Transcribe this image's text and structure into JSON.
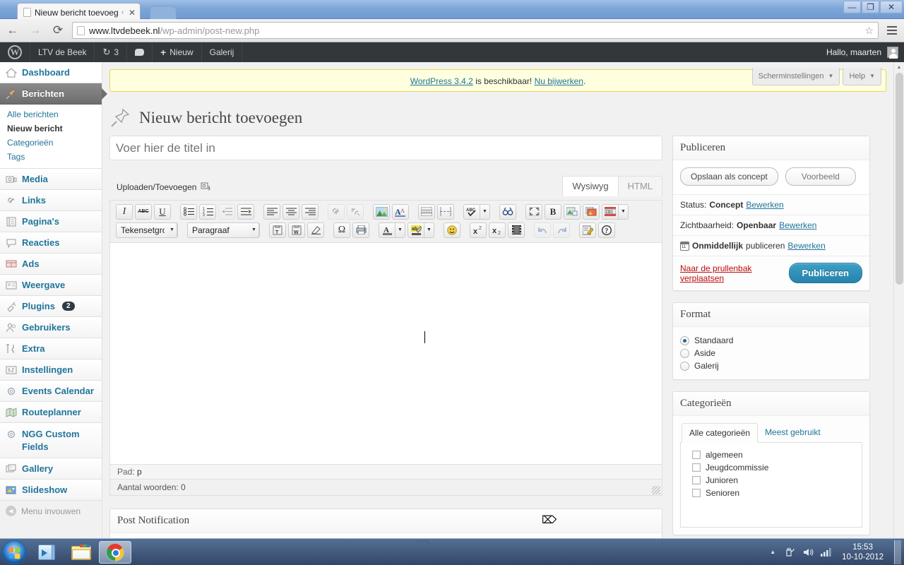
{
  "browser": {
    "tab_title": "Nieuw bericht toevoegen",
    "tab_separator": "‹",
    "tab_close": "✕",
    "back_icon": "←",
    "forward_icon": "→",
    "reload_icon": "⟳",
    "url_host": "www.ltvdebeek.nl",
    "url_path": "/wp-admin/post-new.php",
    "star_icon": "☆",
    "minimize_label": "—",
    "maximize_label": "❐",
    "close_label": "✕"
  },
  "adminbar": {
    "logo": "W",
    "site_name": "LTV de Beek",
    "updates_icon": "↻",
    "updates_count": "3",
    "comments_icon": "💬",
    "new_label": "Nieuw",
    "new_plus": "+",
    "gallery_label": "Galerij",
    "greeting": "Hallo, maarten"
  },
  "sidebar": {
    "items": [
      {
        "label": "Dashboard",
        "icon": "dashboard-icon"
      },
      {
        "label": "Berichten",
        "icon": "posts-pin-icon",
        "current": true
      },
      {
        "label": "Media",
        "icon": "media-icon"
      },
      {
        "label": "Links",
        "icon": "links-icon"
      },
      {
        "label": "Pagina's",
        "icon": "pages-icon"
      },
      {
        "label": "Reacties",
        "icon": "comments-icon"
      },
      {
        "label": "Ads",
        "icon": "ads-icon"
      },
      {
        "label": "Weergave",
        "icon": "appearance-icon"
      },
      {
        "label": "Plugins",
        "icon": "plugins-icon",
        "badge": "2"
      },
      {
        "label": "Gebruikers",
        "icon": "users-icon"
      },
      {
        "label": "Extra",
        "icon": "tools-icon"
      },
      {
        "label": "Instellingen",
        "icon": "settings-icon"
      },
      {
        "label": "Events Calendar",
        "icon": "gear-icon"
      },
      {
        "label": "Routeplanner",
        "icon": "map-icon"
      },
      {
        "label": "NGG Custom Fields",
        "icon": "gear-icon"
      },
      {
        "label": "Gallery",
        "icon": "gallery-icon"
      },
      {
        "label": "Slideshow",
        "icon": "slideshow-icon"
      }
    ],
    "submenu": [
      {
        "label": "Alle berichten"
      },
      {
        "label": "Nieuw bericht",
        "current": true
      },
      {
        "label": "Categorieën"
      },
      {
        "label": "Tags"
      }
    ],
    "collapse_label": "Menu invouwen",
    "collapse_icon": "◀"
  },
  "notice": {
    "link_version": "WordPress 3.4.2",
    "middle_text": " is beschikbaar! ",
    "link_update": "Nu bijwerken",
    "end_text": "."
  },
  "screen_meta": {
    "screen_options": "Scherminstellingen",
    "help": "Help",
    "arrow": "▼"
  },
  "page": {
    "title": "Nieuw bericht toevoegen"
  },
  "title_field": {
    "placeholder": "Voer hier de titel in",
    "value": ""
  },
  "editor": {
    "media_label": "Uploaden/Toevoegen",
    "tabs": [
      {
        "label": "Wysiwyg",
        "active": true
      },
      {
        "label": "HTML",
        "active": false
      }
    ],
    "toolbar_row1": [
      {
        "name": "italic-button",
        "glyph": "I",
        "style": "italic-serif"
      },
      {
        "name": "strikethrough-button",
        "glyph": "ABC",
        "style": "strike"
      },
      {
        "name": "underline-button",
        "glyph": "U",
        "style": "underline"
      },
      {
        "name": "bullet-list-button",
        "glyph": "ul"
      },
      {
        "name": "numbered-list-button",
        "glyph": "ol"
      },
      {
        "name": "outdent-button",
        "glyph": "outdent",
        "disabled": true
      },
      {
        "name": "indent-button",
        "glyph": "indent"
      },
      {
        "name": "align-left-button",
        "glyph": "align-left"
      },
      {
        "name": "align-center-button",
        "glyph": "align-center"
      },
      {
        "name": "align-right-button",
        "glyph": "align-right"
      },
      {
        "name": "insert-link-button",
        "glyph": "link",
        "disabled": true
      },
      {
        "name": "unlink-button",
        "glyph": "unlink",
        "disabled": true
      },
      {
        "name": "insert-image-button",
        "glyph": "image"
      },
      {
        "name": "insert-more-button",
        "glyph": "more-A"
      },
      {
        "name": "read-more-button",
        "glyph": "readmore"
      },
      {
        "name": "page-break-button",
        "glyph": "pagebreak"
      },
      {
        "name": "spellcheck-button",
        "glyph": "spell",
        "split": true
      },
      {
        "name": "search-replace-button",
        "glyph": "binoculars"
      },
      {
        "name": "fullscreen-button",
        "glyph": "fullscreen"
      },
      {
        "name": "bold-button",
        "glyph": "B",
        "style": "bold"
      },
      {
        "name": "insert-media-button",
        "glyph": "media1"
      },
      {
        "name": "insert-gallery-button",
        "glyph": "media2"
      },
      {
        "name": "insert-slideshow-button",
        "glyph": "media3",
        "split": true
      }
    ],
    "select_charset": "Tekensetgroepen",
    "select_paragraph": "Paragraaf",
    "toolbar_row2": [
      {
        "name": "paste-as-text-button",
        "glyph": "paste-t"
      },
      {
        "name": "paste-from-word-button",
        "glyph": "paste-w"
      },
      {
        "name": "remove-formatting-button",
        "glyph": "eraser"
      },
      {
        "name": "special-character-button",
        "glyph": "Ω",
        "style": "omega"
      },
      {
        "name": "print-button",
        "glyph": "printer"
      },
      {
        "name": "text-color-button",
        "glyph": "textcolor",
        "split": true
      },
      {
        "name": "background-color-button",
        "glyph": "bgcolor",
        "split": true
      },
      {
        "name": "smiley-button",
        "glyph": "smiley"
      },
      {
        "name": "superscript-button",
        "glyph": "sup"
      },
      {
        "name": "subscript-button",
        "glyph": "sub"
      },
      {
        "name": "insert-video-button",
        "glyph": "film"
      },
      {
        "name": "undo-button",
        "glyph": "undo",
        "disabled": true
      },
      {
        "name": "redo-button",
        "glyph": "redo",
        "disabled": true
      },
      {
        "name": "custom-button",
        "glyph": "note"
      },
      {
        "name": "help-button",
        "glyph": "question"
      }
    ],
    "status_path_label": "Pad:",
    "status_path_value": "p",
    "wordcount": "Aantal woorden: 0"
  },
  "publish_box": {
    "title": "Publiceren",
    "save_draft": "Opslaan als concept",
    "preview": "Voorbeeld",
    "status_label": "Status:",
    "status_value": "Concept",
    "status_edit": "Bewerken",
    "visibility_label": "Zichtbaarheid:",
    "visibility_value": "Openbaar",
    "visibility_edit": "Bewerken",
    "schedule_value": "Onmiddellijk",
    "schedule_label": "publiceren",
    "schedule_edit": "Bewerken",
    "trash": "Naar de prullenbak verplaatsen",
    "publish": "Publiceren"
  },
  "format_box": {
    "title": "Format",
    "options": [
      {
        "label": "Standaard",
        "checked": true
      },
      {
        "label": "Aside",
        "checked": false
      },
      {
        "label": "Galerij",
        "checked": false
      }
    ]
  },
  "categories_box": {
    "title": "Categorieën",
    "tabs": [
      {
        "label": "Alle categorieën",
        "active": true
      },
      {
        "label": "Meest gebruikt",
        "active": false
      }
    ],
    "items": [
      {
        "label": "algemeen",
        "checked": false
      },
      {
        "label": "Jeugdcommissie",
        "checked": false
      },
      {
        "label": "Junioren",
        "checked": false
      },
      {
        "label": "Senioren",
        "checked": false
      }
    ]
  },
  "postnotification_box": {
    "title": "Post Notification"
  },
  "taskbar": {
    "start_name": "start-orb",
    "items": [
      {
        "name": "windows-media-player",
        "icon": "wmp"
      },
      {
        "name": "windows-explorer",
        "icon": "folder"
      },
      {
        "name": "google-chrome",
        "icon": "chrome",
        "active": true
      }
    ],
    "tray": {
      "show_hidden": "▲",
      "action_center": "🗔",
      "volume": "🔊",
      "network": "▮",
      "time": "15:53",
      "date": "10-10-2012"
    }
  },
  "colors": {
    "wp_blue": "#21759b",
    "admin_bar": "#32373c",
    "accent_publish": "#2683ad",
    "trash_red": "#bc0b0b",
    "notice_bg": "#ffffe0"
  }
}
